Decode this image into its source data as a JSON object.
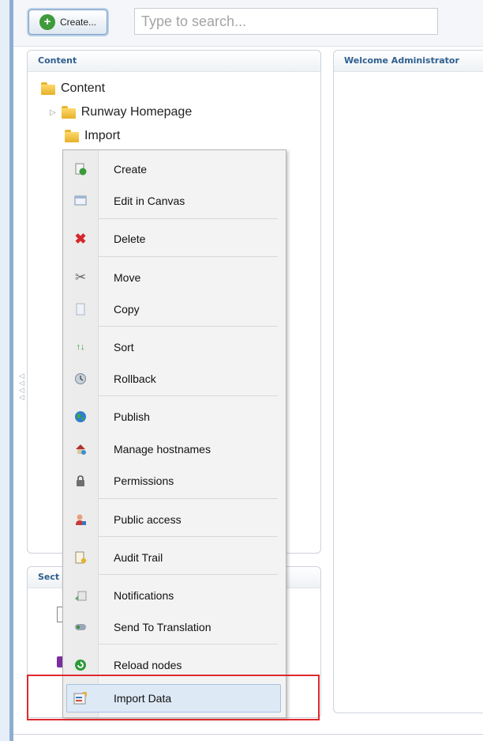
{
  "toolbar": {
    "create_label": "Create...",
    "search_placeholder": "Type to search..."
  },
  "content_panel": {
    "title": "Content",
    "tree": [
      {
        "label": "Content"
      },
      {
        "label": "Runway Homepage"
      },
      {
        "label": "Import"
      }
    ]
  },
  "welcome_panel": {
    "title": "Welcome Administrator"
  },
  "sections_panel": {
    "title": "Sect"
  },
  "context_menu": {
    "items": [
      {
        "label": "Create",
        "icon": "create-page-icon"
      },
      {
        "label": "Edit in Canvas",
        "icon": "canvas-icon"
      },
      {
        "label": "Delete",
        "icon": "delete-x-icon"
      },
      {
        "label": "Move",
        "icon": "scissors-icon"
      },
      {
        "label": "Copy",
        "icon": "copy-icon"
      },
      {
        "label": "Sort",
        "icon": "sort-arrows-icon"
      },
      {
        "label": "Rollback",
        "icon": "rollback-icon"
      },
      {
        "label": "Publish",
        "icon": "globe-icon"
      },
      {
        "label": "Manage hostnames",
        "icon": "hostnames-icon"
      },
      {
        "label": "Permissions",
        "icon": "lock-icon"
      },
      {
        "label": "Public access",
        "icon": "user-icon"
      },
      {
        "label": "Audit Trail",
        "icon": "audit-icon"
      },
      {
        "label": "Notifications",
        "icon": "notifications-icon"
      },
      {
        "label": "Send To Translation",
        "icon": "translation-icon"
      },
      {
        "label": "Reload nodes",
        "icon": "reload-icon"
      },
      {
        "label": "Import Data",
        "icon": "import-data-icon"
      }
    ],
    "highlighted": "Import Data"
  },
  "colors": {
    "accent": "#2f5f8f",
    "highlight_frame": "#e0282e",
    "menu_highlight": "#dde9f5"
  }
}
